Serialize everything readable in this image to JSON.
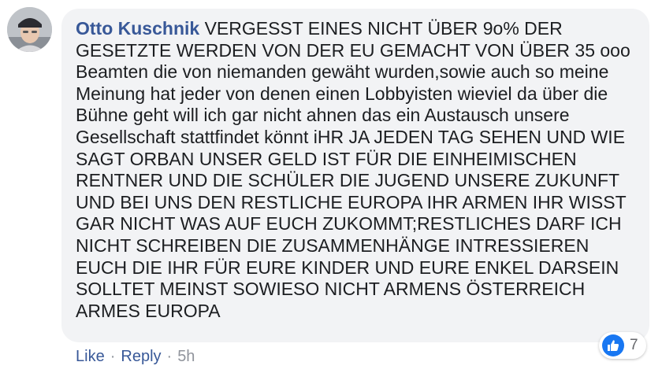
{
  "comment": {
    "author": "Otto Kuschnik",
    "text": "VERGESST EINES NICHT ÜBER 9o% DER GESETZTE WERDEN VON DER EU GEMACHT VON ÜBER 35 ooo Beamten die von niemanden gewäht wurden,sowie auch so meine Meinung hat jeder von denen einen Lobbyisten wieviel da über die Bühne geht will ich gar nicht ahnen das ein Austausch unsere Gesellschaft stattfindet könnt iHR JA JEDEN TAG SEHEN UND WIE SAGT ORBAN UNSER GELD IST FÜR DIE EINHEIMISCHEN RENTNER UND DIE SCHÜLER DIE JUGEND UNSERE ZUKUNFT UND BEI UNS DEN RESTLICHE EUROPA IHR ARMEN IHR WISST GAR NICHT WAS AUF EUCH ZUKOMMT;RESTLICHES DARF ICH NICHT SCHREIBEN DIE ZUSAMMENHÄNGE INTRESSIEREN EUCH DIE IHR FÜR EURE KINDER UND EURE ENKEL DARSEIN SOLLTET MEINST SOWIESO NICHT ARMENS ÖSTERREICH ARMES EUROPA"
  },
  "actions": {
    "like_label": "Like",
    "separator": "·",
    "reply_label": "Reply",
    "timestamp": "5h"
  },
  "reactions": {
    "icon": "thumbs-up-icon",
    "count": "7",
    "color": "#1877f2"
  },
  "colors": {
    "author": "#385898",
    "bubble": "#f2f3f5",
    "text": "#1c1e21",
    "muted": "#90949c"
  }
}
